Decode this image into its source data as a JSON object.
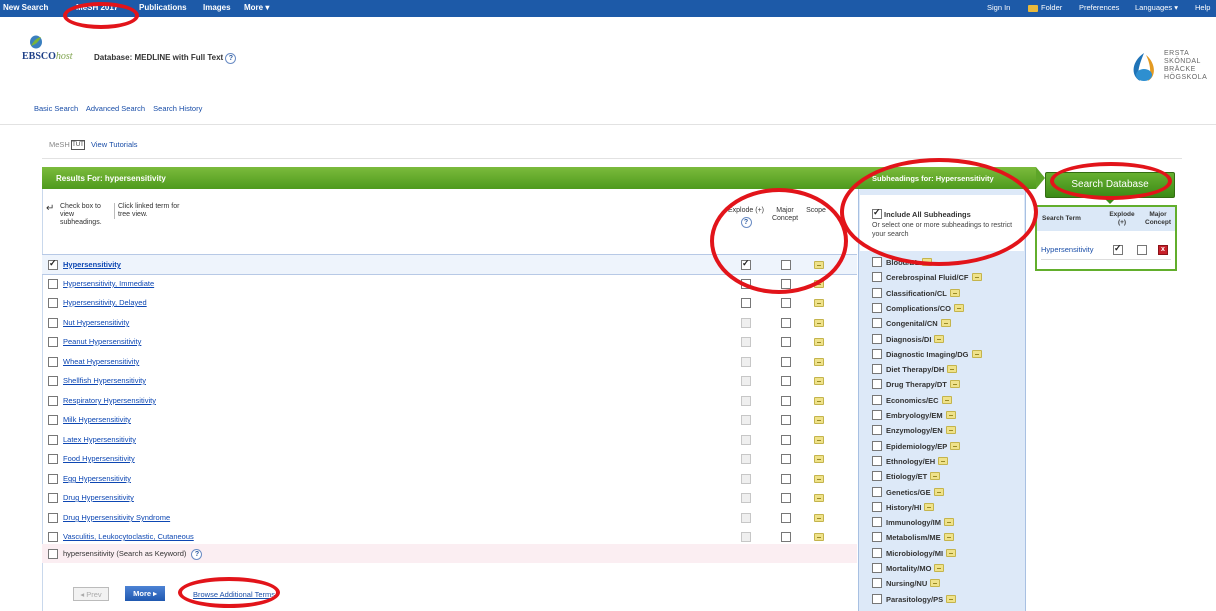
{
  "topnav": {
    "new_search": "New Search",
    "mesh": "MeSH 2017",
    "publications": "Publications",
    "images": "Images",
    "more": "More ▾",
    "sign_in": "Sign In",
    "folder": "Folder",
    "preferences": "Preferences",
    "languages": "Languages ▾",
    "help": "Help"
  },
  "header": {
    "logo_text": "EBSCO",
    "logo_host": "host",
    "database_label": "Database: MEDLINE with Full Text",
    "help_glyph": "?",
    "partner_logo_lines": [
      "ERSTA",
      "SKÖNDAL",
      "BRÄCKE",
      "HÖGSKOLA"
    ]
  },
  "search_links": {
    "basic": "Basic Search",
    "advanced": "Advanced Search",
    "history": "Search History"
  },
  "mesh_bar": {
    "label": "MeSH",
    "tutorial_icon": "TUT",
    "view_tutorials": "View Tutorials"
  },
  "results": {
    "title": "Results For: hypersensitivity",
    "instruction_check": "Check box to view subheadings.",
    "instruction_click": "Click linked term for tree view.",
    "col_explode": "Explode (+)",
    "col_major": "Major Concept",
    "col_scope": "Scope",
    "rows": [
      {
        "term": "Hypersensitivity",
        "selected": true,
        "explode_checked": true
      },
      {
        "term": "Hypersensitivity, Immediate"
      },
      {
        "term": "Hypersensitivity, Delayed"
      },
      {
        "term": "Nut Hypersensitivity"
      },
      {
        "term": "Peanut Hypersensitivity"
      },
      {
        "term": "Wheat Hypersensitivity"
      },
      {
        "term": "Shellfish Hypersensitivity"
      },
      {
        "term": "Respiratory Hypersensitivity"
      },
      {
        "term": "Milk Hypersensitivity"
      },
      {
        "term": "Latex Hypersensitivity"
      },
      {
        "term": "Food Hypersensitivity"
      },
      {
        "term": "Egg Hypersensitivity"
      },
      {
        "term": "Drug Hypersensitivity"
      },
      {
        "term": "Drug Hypersensitivity Syndrome"
      },
      {
        "term": "Vasculitis, Leukocytoclastic, Cutaneous"
      }
    ],
    "keyword_row": "hypersensitivity (Search as Keyword)"
  },
  "subheadings": {
    "title": "Subheadings for: Hypersensitivity",
    "include_all": "Include All Subheadings",
    "include_hint": "Or select one or more subheadings to restrict your search",
    "items": [
      "Blood/BL",
      "Cerebrospinal Fluid/CF",
      "Classification/CL",
      "Complications/CO",
      "Congenital/CN",
      "Diagnosis/DI",
      "Diagnostic Imaging/DG",
      "Diet Therapy/DH",
      "Drug Therapy/DT",
      "Economics/EC",
      "Embryology/EM",
      "Enzymology/EN",
      "Epidemiology/EP",
      "Ethnology/EH",
      "Etiology/ET",
      "Genetics/GE",
      "History/HI",
      "Immunology/IM",
      "Metabolism/ME",
      "Microbiology/MI",
      "Mortality/MO",
      "Nursing/NU",
      "Parasitology/PS"
    ]
  },
  "search_panel": {
    "button": "Search Database",
    "col_term": "Search Term",
    "col_explode": "Explode (+)",
    "col_major": "Major Concept",
    "entry_term": "Hypersensitivity",
    "delete_glyph": "x"
  },
  "pagination": {
    "prev": "◂  Prev",
    "more": "More ▸",
    "browse": "Browse Additional Terms"
  },
  "colors": {
    "nav_blue": "#1d5aa8",
    "green_bar": "#5da528",
    "annotation_red": "#e2141a",
    "link_blue": "#1a4ea8"
  }
}
